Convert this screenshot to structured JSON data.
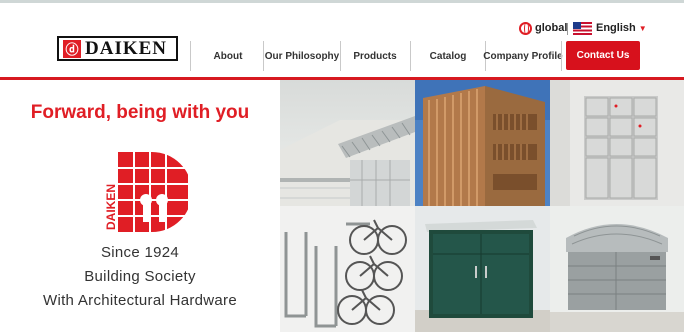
{
  "header": {
    "logo_mark": "ⓓ",
    "logo_text": "DAIKEN",
    "global_label": "global",
    "language_label": "English"
  },
  "nav": {
    "items": [
      "About",
      "Our Philosophy",
      "Products",
      "Catalog",
      "Company Profile"
    ],
    "contact_label": "Contact Us"
  },
  "hero": {
    "tagline": "Forward, being with you",
    "emblem_text": "DAIKEN",
    "lines": [
      "Since 1924",
      "Building Society",
      "With Architectural Hardware"
    ]
  },
  "tiles": [
    {
      "name": "canopy-photo"
    },
    {
      "name": "wood-louver-building-photo"
    },
    {
      "name": "locker-photo"
    },
    {
      "name": "bicycle-rack-photo"
    },
    {
      "name": "storage-shed-photo"
    },
    {
      "name": "garbage-station-photo"
    }
  ],
  "colors": {
    "brand_red": "#d7111c",
    "text": "#333333"
  }
}
